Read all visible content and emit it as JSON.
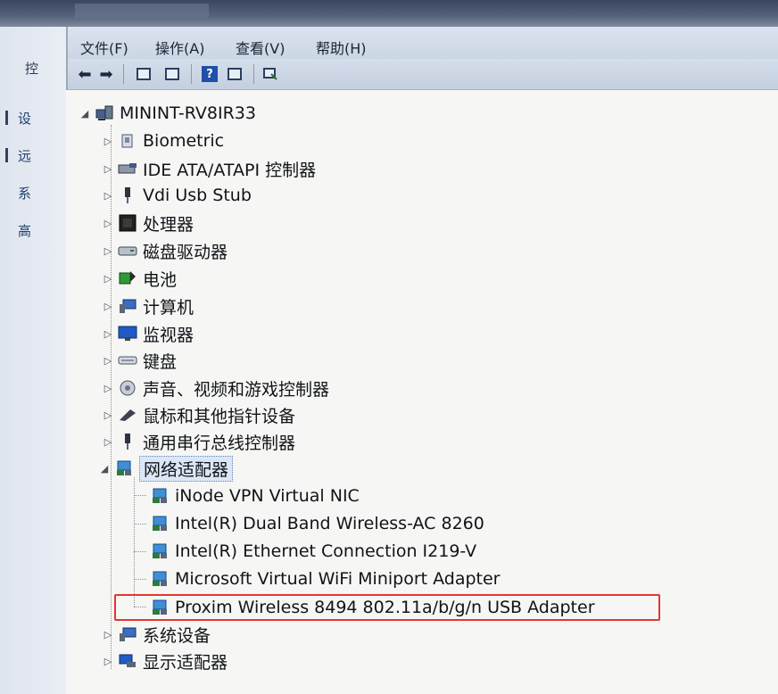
{
  "background_panel": {
    "title": "控",
    "links": [
      "设",
      "远",
      "系",
      "高"
    ]
  },
  "menu": [
    "文件(F)",
    "操作(A)",
    "查看(V)",
    "帮助(H)"
  ],
  "toolbar_icons": [
    "back-arrow-icon",
    "forward-arrow-icon",
    "show-hide-tree-icon",
    "properties-icon",
    "help-icon",
    "view-icon",
    "update-driver-icon"
  ],
  "tree": {
    "root": "MININT-RV8IR33",
    "categories": [
      {
        "label": "Biometric",
        "icon": "biometric-icon",
        "expanded": false
      },
      {
        "label": "IDE ATA/ATAPI 控制器",
        "icon": "ide-controller-icon",
        "expanded": false
      },
      {
        "label": "Vdi Usb Stub",
        "icon": "usb-plug-icon",
        "expanded": false
      },
      {
        "label": "处理器",
        "icon": "processor-icon",
        "expanded": false
      },
      {
        "label": "磁盘驱动器",
        "icon": "disk-drive-icon",
        "expanded": false
      },
      {
        "label": "电池",
        "icon": "battery-icon",
        "expanded": false
      },
      {
        "label": "计算机",
        "icon": "computer-icon",
        "expanded": false
      },
      {
        "label": "监视器",
        "icon": "monitor-icon",
        "expanded": false
      },
      {
        "label": "键盘",
        "icon": "keyboard-icon",
        "expanded": false
      },
      {
        "label": "声音、视频和游戏控制器",
        "icon": "speaker-icon",
        "expanded": false
      },
      {
        "label": "鼠标和其他指针设备",
        "icon": "mouse-icon",
        "expanded": false
      },
      {
        "label": "通用串行总线控制器",
        "icon": "usb-plug-icon",
        "expanded": false
      },
      {
        "label": "网络适配器",
        "icon": "network-adapter-icon",
        "expanded": true
      }
    ],
    "network_adapters": [
      "iNode VPN Virtual NIC",
      "Intel(R) Dual Band Wireless-AC 8260",
      "Intel(R) Ethernet Connection I219-V",
      "Microsoft Virtual WiFi Miniport Adapter",
      "Proxim Wireless 8494 802.11a/b/g/n USB Adapter"
    ],
    "after": [
      {
        "label": "系统设备",
        "icon": "system-device-icon"
      },
      {
        "label": "显示适配器",
        "icon": "display-adapter-icon"
      }
    ]
  },
  "highlight_color": "#e2372f"
}
